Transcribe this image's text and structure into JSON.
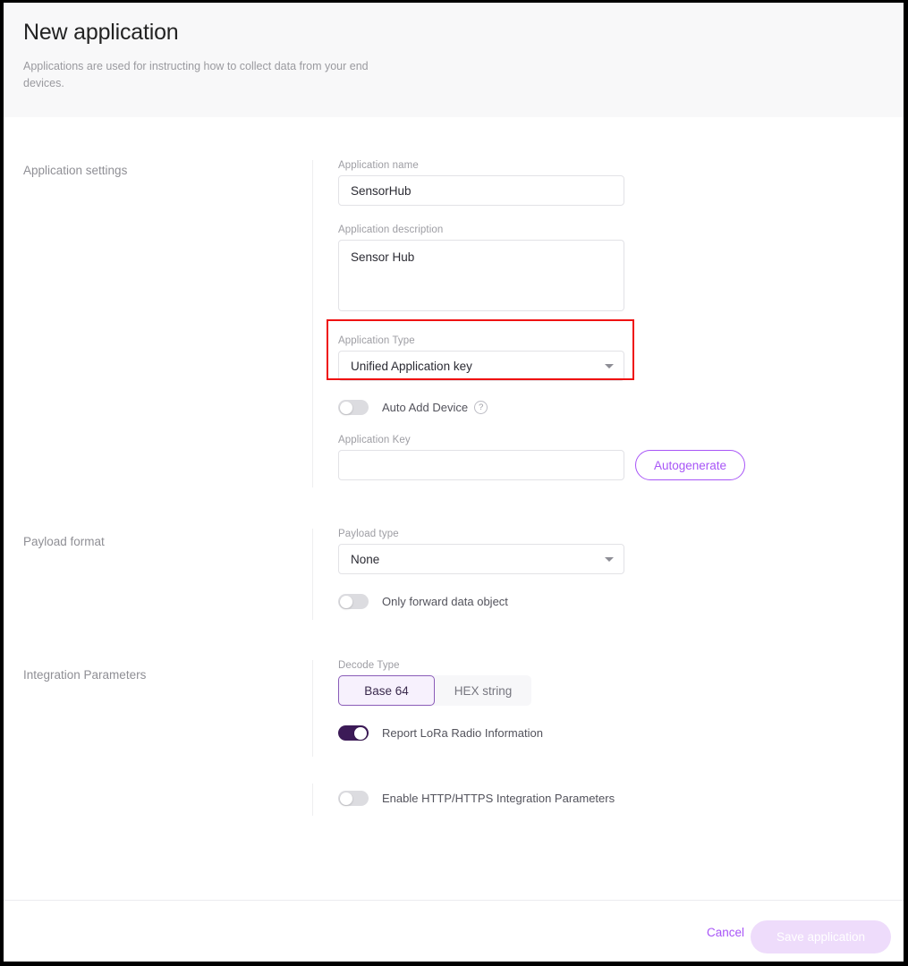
{
  "header": {
    "title": "New application",
    "subtitle": "Applications are used for instructing how to collect data from your end devices."
  },
  "sections": {
    "application_settings": {
      "label": "Application settings",
      "name_label": "Application name",
      "name_value": "SensorHub",
      "name_placeholder": "",
      "description_label": "Application description",
      "description_value": "Sensor Hub",
      "description_placeholder": "",
      "type_label": "Application Type",
      "type_value": "Unified Application key",
      "type_options": [
        "Unified Application key"
      ],
      "auto_add_device_label": "Auto Add Device",
      "auto_add_device_state": "off",
      "help_glyph": "?",
      "app_key_label": "Application Key",
      "app_key_value": "",
      "app_key_placeholder": "",
      "autogenerate_label": "Autogenerate"
    },
    "payload_format": {
      "label": "Payload format",
      "payload_type_label": "Payload type",
      "payload_type_value": "None",
      "payload_type_options": [
        "None"
      ],
      "only_forward_label": "Only forward data object",
      "only_forward_state": "off"
    },
    "integration_parameters": {
      "label": "Integration Parameters",
      "decode_type_label": "Decode Type",
      "decode_options": [
        "Base 64",
        "HEX string"
      ],
      "decode_selected": "Base 64",
      "report_lora_label": "Report LoRa Radio Information",
      "report_lora_state": "on",
      "enable_http_label": "Enable HTTP/HTTPS Integration Parameters",
      "enable_http_state": "off"
    }
  },
  "footer": {
    "cancel_label": "Cancel",
    "save_label": "Save application",
    "save_enabled": false
  },
  "colors": {
    "accent_purple": "#a855f7",
    "toggle_on": "#3c1a57",
    "highlight_red": "#ef1111",
    "header_band": "#f8f8f9",
    "save_disabled_bg": "#eedcfb"
  }
}
